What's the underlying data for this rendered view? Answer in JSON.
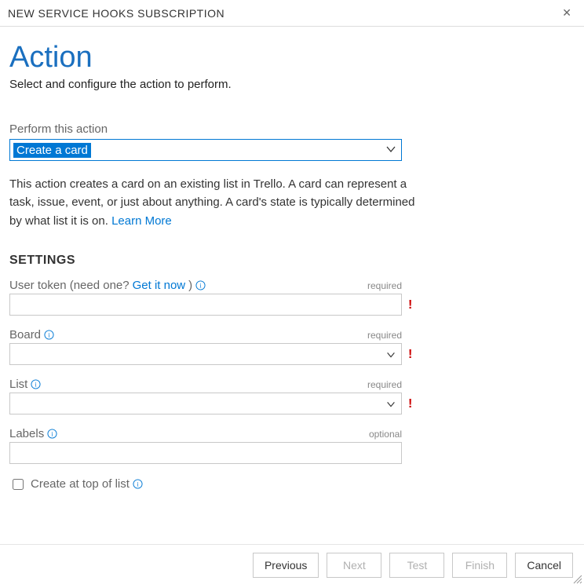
{
  "titlebar": {
    "title": "NEW SERVICE HOOKS SUBSCRIPTION",
    "close_label": "✕"
  },
  "header": {
    "title": "Action",
    "subtitle": "Select and configure the action to perform."
  },
  "action_select": {
    "label": "Perform this action",
    "value": "Create a card"
  },
  "description": {
    "text_a": "This action creates a card on an existing list in Trello. A card can represent a task, issue, event, or just about anything. A card's state is typically determined by what list it is on. ",
    "link": "Learn More"
  },
  "settings": {
    "heading": "SETTINGS",
    "user_token": {
      "label_pre": "User token (need one? ",
      "label_link": "Get it now",
      "label_post": ")",
      "req": "required",
      "value": ""
    },
    "board": {
      "label": "Board",
      "req": "required",
      "value": ""
    },
    "list": {
      "label": "List",
      "req": "required",
      "value": ""
    },
    "labels": {
      "label": "Labels",
      "req": "optional",
      "value": ""
    },
    "create_top": {
      "label": "Create at top of list",
      "checked": false
    }
  },
  "footer": {
    "previous": "Previous",
    "next": "Next",
    "test": "Test",
    "finish": "Finish",
    "cancel": "Cancel"
  }
}
